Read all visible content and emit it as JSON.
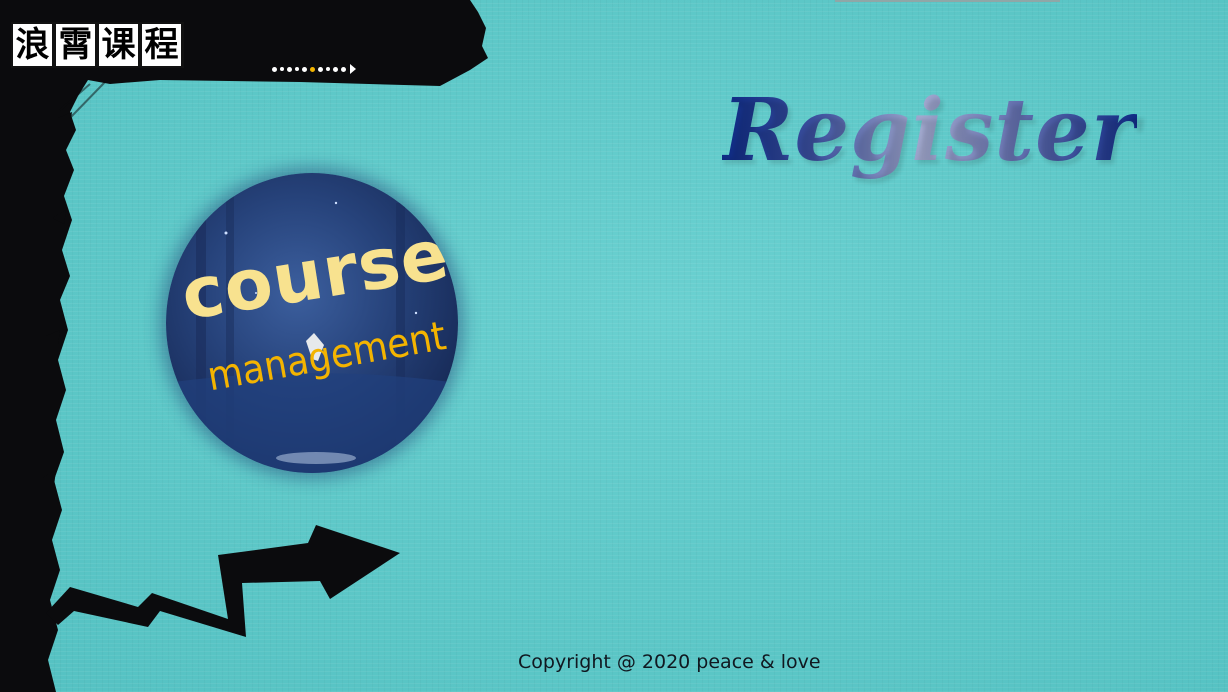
{
  "brand": {
    "logo_chars": [
      "浪",
      "霄",
      "课",
      "程"
    ]
  },
  "register": {
    "title": "Register"
  },
  "badge": {
    "line1": "course",
    "line2": "management"
  },
  "footer": {
    "copyright": "Copyright @ 2020 peace & love"
  },
  "colors": {
    "background": "#5ec9c9",
    "brush": "#0b0b0d",
    "badge_text_primary": "#f8e28f",
    "badge_text_secondary": "#f4b400",
    "title_gradient_dark": "#0d2a84",
    "title_gradient_light": "#a2a9cf",
    "dot_accent": "#f2b400"
  },
  "icons": {
    "progress_dots": "dots-arrow-icon",
    "arrow": "zigzag-arrow-icon",
    "moon": "crescent-moon-icon"
  }
}
